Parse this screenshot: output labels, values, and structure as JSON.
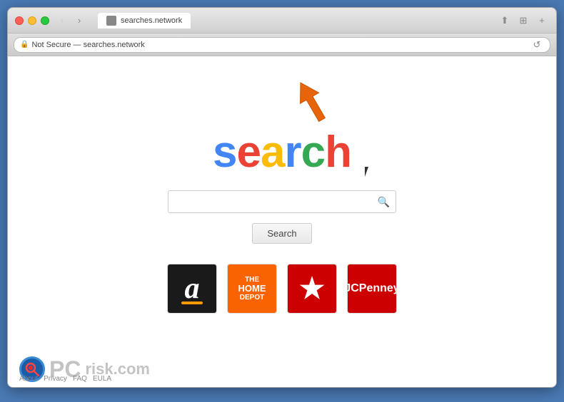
{
  "browser": {
    "title": "Not Secure — searches.network",
    "address": "searches.network",
    "address_label": "Not Secure — searches.network",
    "tab_label": "searches.network"
  },
  "page": {
    "logo_text": "search",
    "search_placeholder": "",
    "search_button_label": "Search",
    "shortcuts": [
      {
        "name": "Amazon",
        "type": "amazon"
      },
      {
        "name": "The Home Depot",
        "type": "homedepot"
      },
      {
        "name": "Macy's",
        "type": "macys"
      },
      {
        "name": "JCPenney",
        "type": "jcpenney"
      }
    ]
  },
  "footer": {
    "links": [
      "About",
      "Privacy",
      "FAQ",
      "EULA"
    ]
  },
  "nav": {
    "back_label": "‹",
    "forward_label": "›",
    "reload_label": "↺",
    "share_label": "⬆",
    "tab_label": "⊞",
    "add_label": "+"
  }
}
